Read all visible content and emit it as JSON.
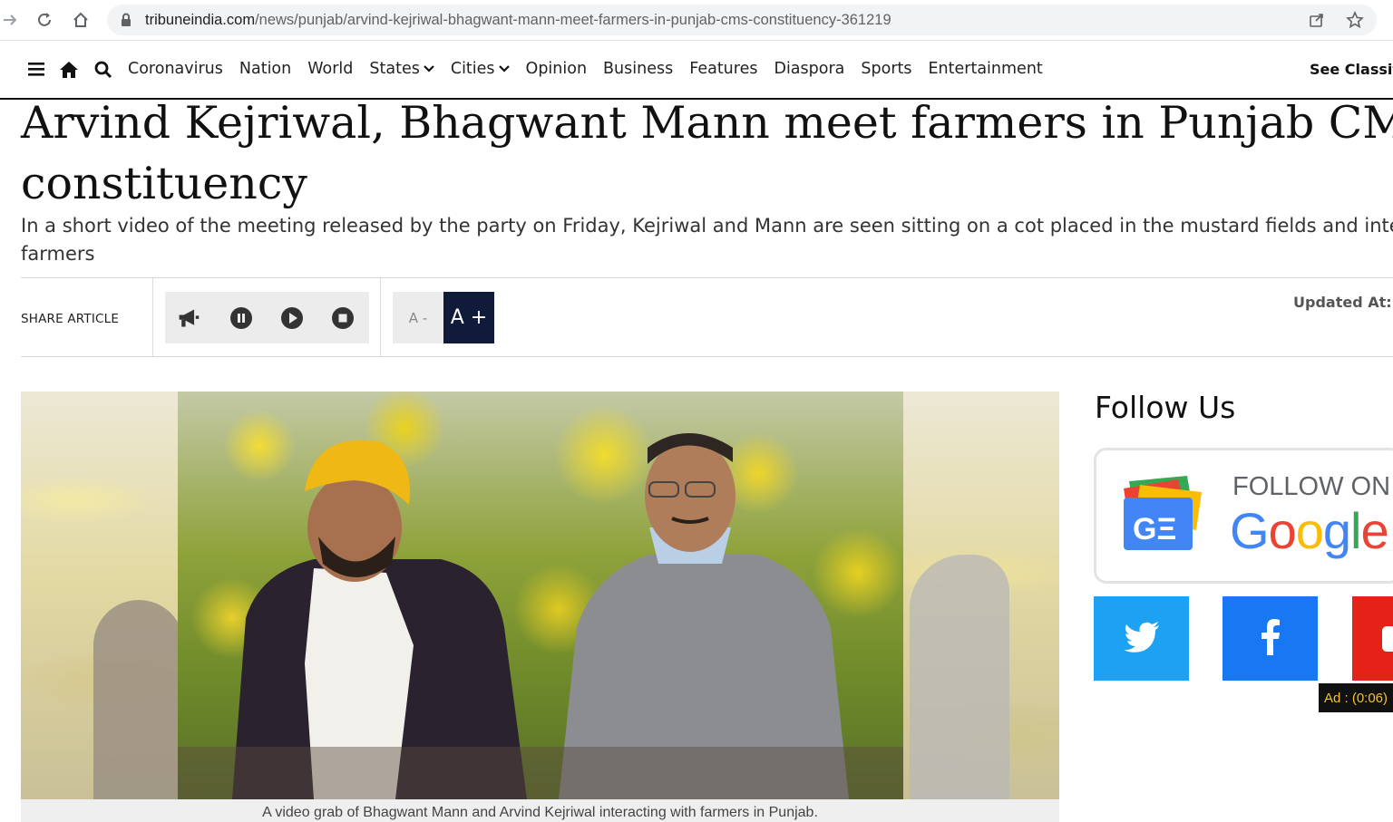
{
  "browser": {
    "url_host": "tribuneindia.com",
    "url_path": "/news/punjab/arvind-kejriwal-bhagwant-mann-meet-farmers-in-punjab-cms-constituency-361219"
  },
  "nav": {
    "items": [
      "Coronavirus",
      "Nation",
      "World",
      "States",
      "Cities",
      "Opinion",
      "Business",
      "Features",
      "Diaspora",
      "Sports",
      "Entertainment"
    ],
    "see_classified": "See Classifi"
  },
  "article": {
    "headline_line1": "Arvind Kejriwal, Bhagwant Mann meet farmers in Punjab CM's",
    "headline_line2": "constituency",
    "subhead_line1": "In a short video of the meeting released by the party on Friday, Kejriwal and Mann are seen sitting on a cot placed in the mustard fields and inter",
    "subhead_line2": "farmers",
    "caption": "A video grab of Bhagwant Mann and Arvind Kejriwal interacting with farmers in Punjab."
  },
  "toolbar": {
    "share_label": "SHARE ARTICLE",
    "font_minus": "A -",
    "font_plus": "A +",
    "updated_label": "Updated At:"
  },
  "sidebar": {
    "follow_title": "Follow Us",
    "gnews_follow": "FOLLOW ON",
    "gnews_word": "Google"
  },
  "ad": {
    "badge": "Ad : (0:06)"
  },
  "colors": {
    "accent_dark": "#0f1b38",
    "twitter": "#1da1f2",
    "facebook": "#1877f2",
    "youtube": "#e62117",
    "ad_text": "#f3c22e"
  }
}
